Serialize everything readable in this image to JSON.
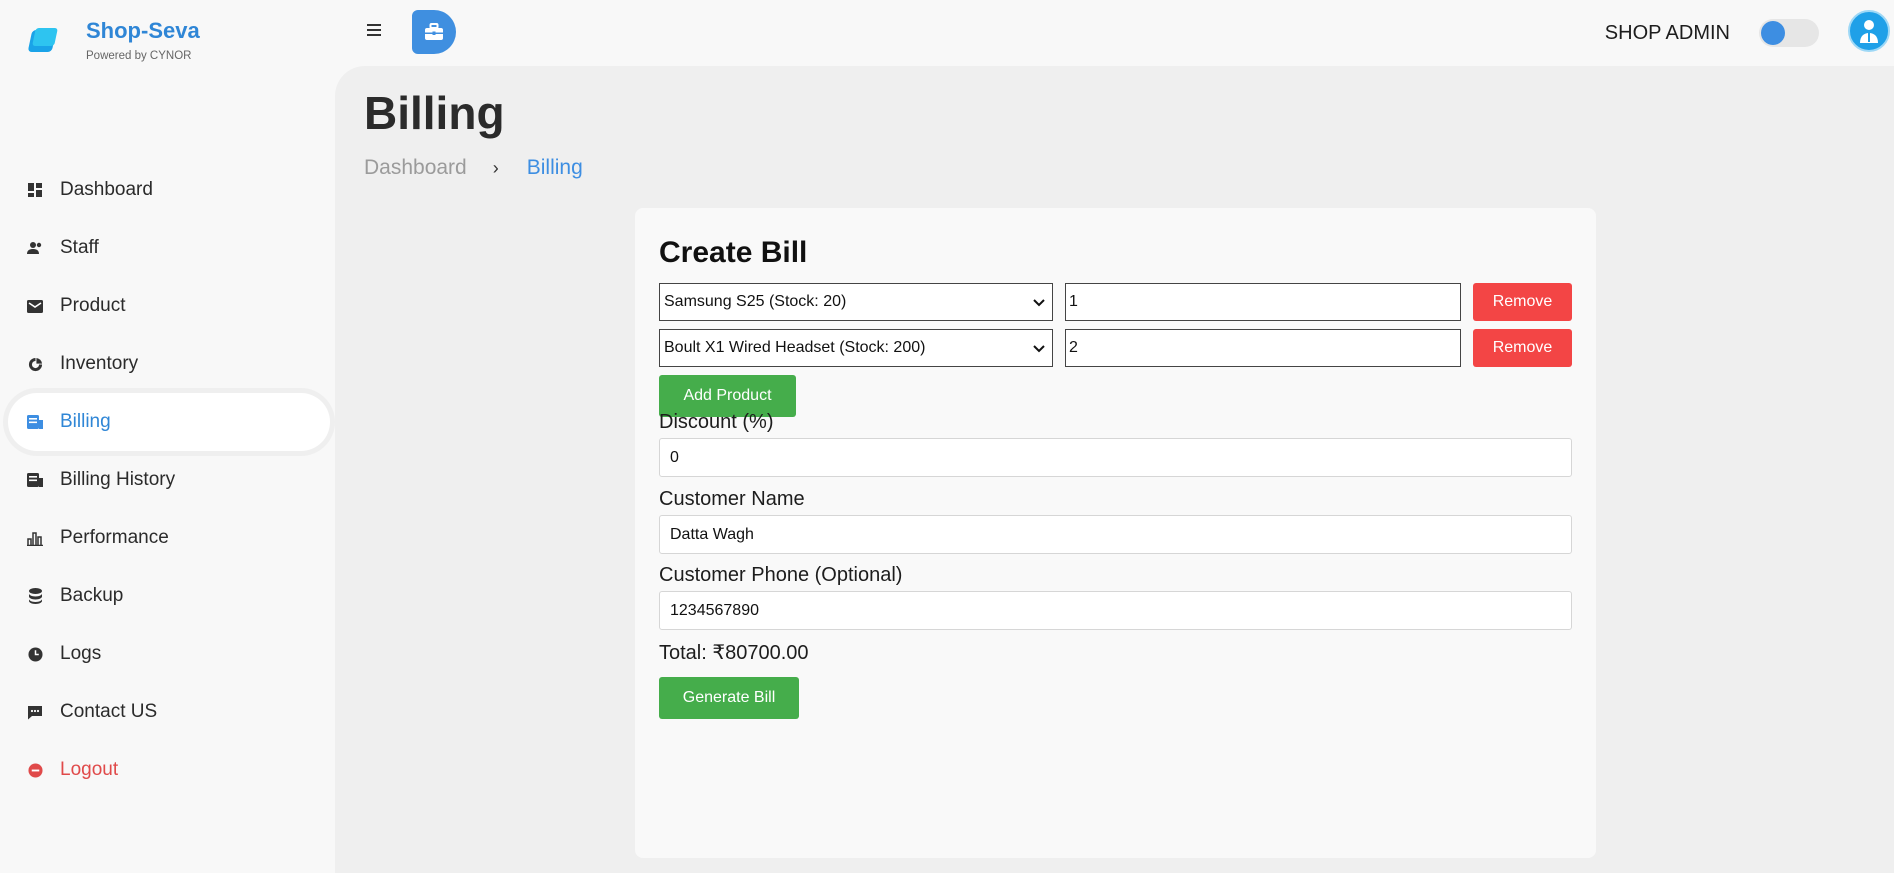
{
  "brand": {
    "title": "Shop-Seva",
    "subtitle": "Powered by CYNOR"
  },
  "sidebar": {
    "items": [
      {
        "label": "Dashboard",
        "icon": "dashboard-icon"
      },
      {
        "label": "Staff",
        "icon": "staff-icon"
      },
      {
        "label": "Product",
        "icon": "product-icon"
      },
      {
        "label": "Inventory",
        "icon": "inventory-icon"
      },
      {
        "label": "Billing",
        "icon": "billing-icon",
        "active": true
      },
      {
        "label": "Billing History",
        "icon": "billing-history-icon"
      },
      {
        "label": "Performance",
        "icon": "performance-icon"
      },
      {
        "label": "Backup",
        "icon": "backup-icon"
      },
      {
        "label": "Logs",
        "icon": "logs-icon"
      },
      {
        "label": "Contact US",
        "icon": "contact-icon"
      },
      {
        "label": "Logout",
        "icon": "logout-icon"
      }
    ]
  },
  "header": {
    "admin_label": "SHOP ADMIN",
    "theme_toggle": "off"
  },
  "page": {
    "title": "Billing",
    "breadcrumb": {
      "home": "Dashboard",
      "separator": "›",
      "current": "Billing"
    }
  },
  "form": {
    "title": "Create Bill",
    "products": [
      {
        "selected": "Samsung S25 (Stock: 20)",
        "quantity": "1",
        "remove_label": "Remove"
      },
      {
        "selected": "Boult X1 Wired Headset (Stock: 200)",
        "quantity": "2",
        "remove_label": "Remove"
      }
    ],
    "add_product_label": "Add Product",
    "discount": {
      "label": "Discount (%)",
      "value": "0"
    },
    "customer_name": {
      "label": "Customer Name",
      "value": "Datta Wagh"
    },
    "customer_phone": {
      "label": "Customer Phone (Optional)",
      "value": "1234567890"
    },
    "total": "Total: ₹80700.00",
    "generate_label": "Generate Bill"
  },
  "colors": {
    "accent": "#3d8ee2",
    "remove": "#f34545",
    "success": "#45ad4b",
    "logout": "#e04a4a"
  }
}
